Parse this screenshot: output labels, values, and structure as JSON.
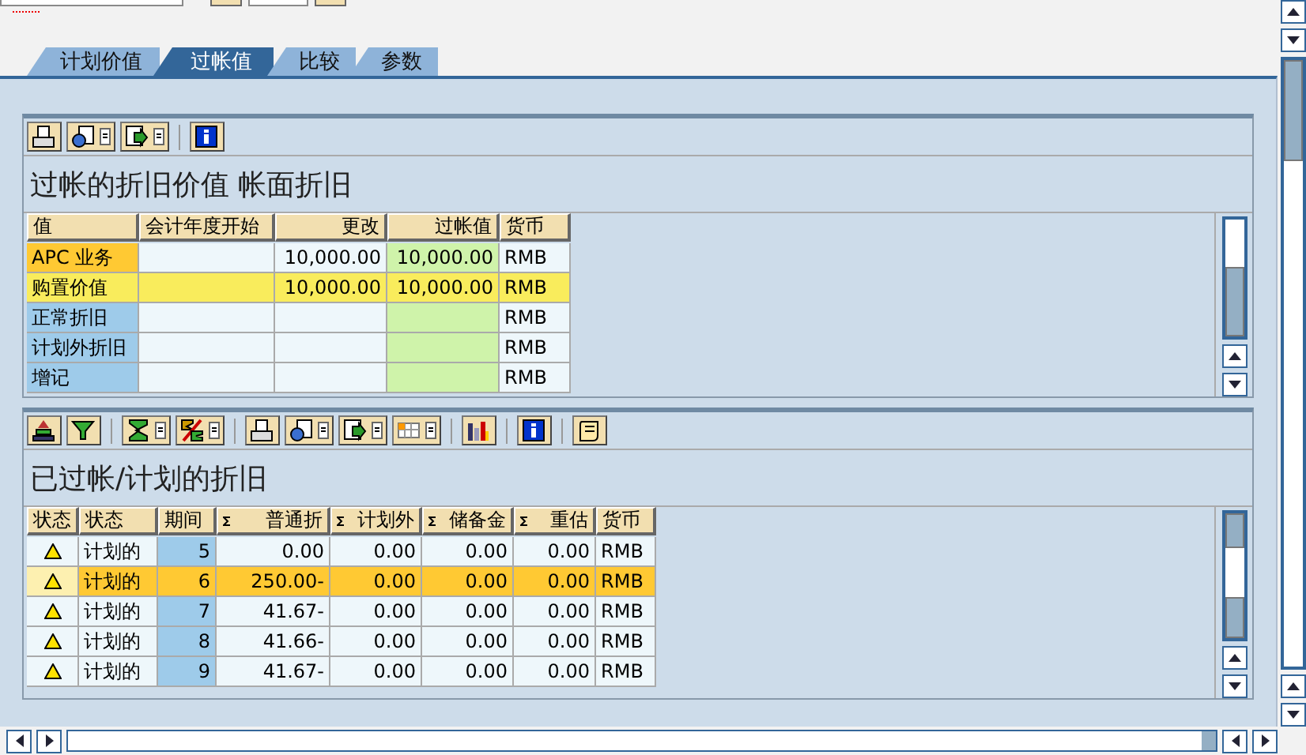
{
  "tabs": [
    {
      "label": "计划价值",
      "selected": false
    },
    {
      "label": "过帐值",
      "selected": true
    },
    {
      "label": "比较",
      "selected": false
    },
    {
      "label": "参数",
      "selected": false
    }
  ],
  "values_grid": {
    "title": "过帐的折旧价值 帐面折旧",
    "columns": [
      "值",
      "会计年度开始",
      "更改",
      "过帐值",
      "货币"
    ],
    "rows": [
      {
        "value": "APC 业务",
        "fiscal_year_start": "",
        "change": "10,000.00",
        "posted": "10,000.00",
        "currency": "RMB",
        "selected": false,
        "focused": true
      },
      {
        "value": "购置价值",
        "fiscal_year_start": "",
        "change": "10,000.00",
        "posted": "10,000.00",
        "currency": "RMB",
        "selected": true,
        "focused": false
      },
      {
        "value": "正常折旧",
        "fiscal_year_start": "",
        "change": "",
        "posted": "",
        "currency": "RMB",
        "selected": false,
        "focused": false
      },
      {
        "value": "计划外折旧",
        "fiscal_year_start": "",
        "change": "",
        "posted": "",
        "currency": "RMB",
        "selected": false,
        "focused": false
      },
      {
        "value": "增记",
        "fiscal_year_start": "",
        "change": "",
        "posted": "",
        "currency": "RMB",
        "selected": false,
        "focused": false
      }
    ]
  },
  "depreciation_grid": {
    "title": "已过帐/计划的折旧",
    "columns": [
      {
        "label": "状态",
        "sum": false
      },
      {
        "label": "状态",
        "sum": false
      },
      {
        "label": "期间",
        "sum": false
      },
      {
        "label": "普通折",
        "sum": true
      },
      {
        "label": "计划外",
        "sum": true
      },
      {
        "label": "储备金",
        "sum": true
      },
      {
        "label": "重估",
        "sum": true
      },
      {
        "label": "货币",
        "sum": false
      }
    ],
    "rows": [
      {
        "status": "计划的",
        "period": "5",
        "ordinary": "0.00",
        "unplanned": "0.00",
        "reserve": "0.00",
        "revaluation": "0.00",
        "currency": "RMB",
        "selected": false
      },
      {
        "status": "计划的",
        "period": "6",
        "ordinary": "250.00-",
        "unplanned": "0.00",
        "reserve": "0.00",
        "revaluation": "0.00",
        "currency": "RMB",
        "selected": true
      },
      {
        "status": "计划的",
        "period": "7",
        "ordinary": "41.67-",
        "unplanned": "0.00",
        "reserve": "0.00",
        "revaluation": "0.00",
        "currency": "RMB",
        "selected": false
      },
      {
        "status": "计划的",
        "period": "8",
        "ordinary": "41.66-",
        "unplanned": "0.00",
        "reserve": "0.00",
        "revaluation": "0.00",
        "currency": "RMB",
        "selected": false
      },
      {
        "status": "计划的",
        "period": "9",
        "ordinary": "41.67-",
        "unplanned": "0.00",
        "reserve": "0.00",
        "revaluation": "0.00",
        "currency": "RMB",
        "selected": false
      }
    ]
  }
}
